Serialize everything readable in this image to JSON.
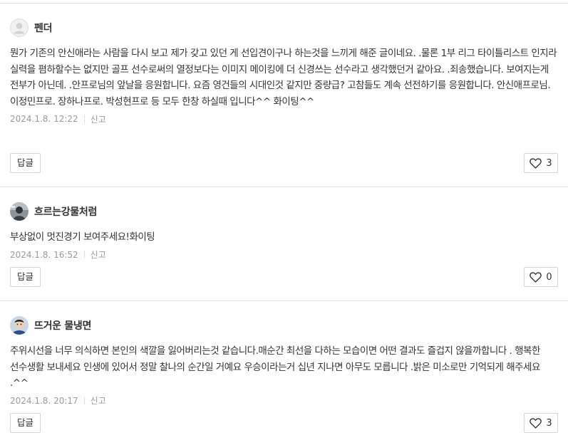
{
  "comments": [
    {
      "nickname": "펜더",
      "avatar": "default-user-icon",
      "text": "뭔가 기존의 안신애라는 사람을 다시 보고 제가 갖고 있던 게 선입견이구나 하는것을 느끼게 해준 글이네요. .물론 1부 리그 타이틀리스트 인지라 실력을 폄하할수는 없지만 골프 선수로써의 열정보다는 이미지 메이킹에 더 신경쓰는 선수라고 생각했던거 같아요. .죄송했습니다. 보여지는게 전부가 아닌데. .안프로님의 앞날을 응원합니다. 요즘 영건들의 시대인것 같지만 중량급? 고참들도 계속 선전하기를 응원합니다. 안신애프로님. 이정민프로. 장하나프로. 박성현프로 등 모두 한창 하실때 입니다^^ 화이팅^^",
      "date": "2024.1.8. 12:22",
      "report_label": "신고",
      "reply_label": "답글",
      "likes": "3"
    },
    {
      "nickname": "흐르는강물처럼",
      "avatar": "profile-photo",
      "text": "부상없이 멋진경기 보여주세요!화이팅",
      "date": "2024.1.8. 16:52",
      "report_label": "신고",
      "reply_label": "답글",
      "likes": "0"
    },
    {
      "nickname": "뜨거운 물냉면",
      "avatar": "profile-photo",
      "text": "주위시선을 너무 의식하면 본인의 색깔을 잃어버리는것 같습니다.매순간 최선을 다하는 모습이면 어떤 결과도 즐겁지 않을까합니다 . 행복한 선수생활 보내세요 인생에 있어서 정말 찰나의 순간일 거예요 우승이라는거 십년 지나면 아무도 모릅니다 .밝은 미소로만 기억되게 해주세요 .^^",
      "date": "2024.1.8. 20:17",
      "report_label": "신고",
      "reply_label": "답글",
      "likes": "3"
    }
  ],
  "colors": {
    "divider": "#e2e2e2",
    "meta_text": "#9a9a9a",
    "body_text": "#333333",
    "button_border": "#d4d4d4"
  }
}
